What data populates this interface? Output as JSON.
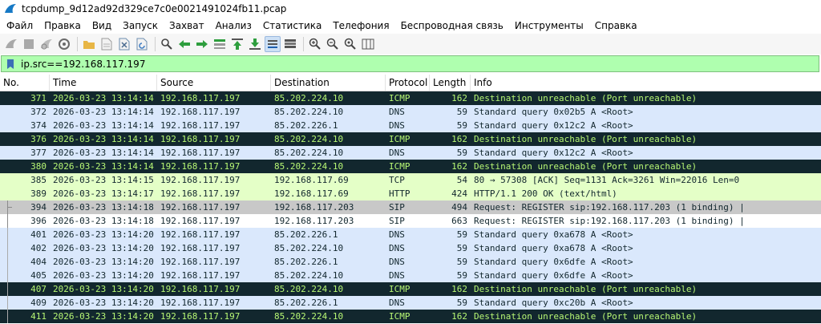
{
  "window": {
    "title": "tcpdump_9d12ad92d329ce7c0e0021491024fb11.pcap"
  },
  "menu": [
    "Файл",
    "Правка",
    "Вид",
    "Запуск",
    "Захват",
    "Анализ",
    "Статистика",
    "Телефония",
    "Беспроводная связь",
    "Инструменты",
    "Справка"
  ],
  "toolbar": {
    "icons": [
      "shark-fin-start-icon",
      "stop-square-icon",
      "restart-fin-icon",
      "capture-options-icon",
      "open-folder-icon",
      "save-file-icon",
      "close-file-icon",
      "reload-icon",
      "find-icon",
      "back-arrow-icon",
      "forward-arrow-icon",
      "goto-packet-icon",
      "first-packet-icon",
      "last-packet-icon",
      "autoscroll-icon",
      "colorize-icon",
      "zoom-in-icon",
      "zoom-out-icon",
      "zoom-normal-icon",
      "resize-columns-icon"
    ],
    "accent": "#2e9e3e"
  },
  "filter": {
    "value": "ip.src==192.168.117.197"
  },
  "columns": [
    "No.",
    "Time",
    "Source",
    "Destination",
    "Protocol",
    "Length",
    "Info"
  ],
  "packets": [
    {
      "no": "371",
      "time": "2026-03-23 13:14:14",
      "src": "192.168.117.197",
      "dst": "85.202.224.10",
      "proto": "ICMP",
      "len": "162",
      "info": "Destination unreachable (Port unreachable)",
      "style": "icmp"
    },
    {
      "no": "372",
      "time": "2026-03-23 13:14:14",
      "src": "192.168.117.197",
      "dst": "85.202.224.10",
      "proto": "DNS",
      "len": "59",
      "info": "Standard query 0x02b5 A <Root>",
      "style": "dns"
    },
    {
      "no": "374",
      "time": "2026-03-23 13:14:14",
      "src": "192.168.117.197",
      "dst": "85.202.226.1",
      "proto": "DNS",
      "len": "59",
      "info": "Standard query 0x12c2 A <Root>",
      "style": "dns"
    },
    {
      "no": "376",
      "time": "2026-03-23 13:14:14",
      "src": "192.168.117.197",
      "dst": "85.202.224.10",
      "proto": "ICMP",
      "len": "162",
      "info": "Destination unreachable (Port unreachable)",
      "style": "icmp"
    },
    {
      "no": "377",
      "time": "2026-03-23 13:14:14",
      "src": "192.168.117.197",
      "dst": "85.202.224.10",
      "proto": "DNS",
      "len": "59",
      "info": "Standard query 0x12c2 A <Root>",
      "style": "dns"
    },
    {
      "no": "380",
      "time": "2026-03-23 13:14:14",
      "src": "192.168.117.197",
      "dst": "85.202.224.10",
      "proto": "ICMP",
      "len": "162",
      "info": "Destination unreachable (Port unreachable)",
      "style": "icmp"
    },
    {
      "no": "385",
      "time": "2026-03-23 13:14:15",
      "src": "192.168.117.197",
      "dst": "192.168.117.69",
      "proto": "TCP",
      "len": "54",
      "info": "80 → 57308 [ACK] Seq=1131 Ack=3261 Win=22016 Len=0",
      "style": "tcp"
    },
    {
      "no": "389",
      "time": "2026-03-23 13:14:17",
      "src": "192.168.117.197",
      "dst": "192.168.117.69",
      "proto": "HTTP",
      "len": "424",
      "info": "HTTP/1.1 200 OK  (text/html)",
      "style": "http"
    },
    {
      "no": "394",
      "time": "2026-03-23 13:14:18",
      "src": "192.168.117.197",
      "dst": "192.168.117.203",
      "proto": "SIP",
      "len": "494",
      "info": "Request: REGISTER sip:192.168.117.203  (1 binding) |",
      "style": "sip selected"
    },
    {
      "no": "396",
      "time": "2026-03-23 13:14:18",
      "src": "192.168.117.197",
      "dst": "192.168.117.203",
      "proto": "SIP",
      "len": "663",
      "info": "Request: REGISTER sip:192.168.117.203  (1 binding) |",
      "style": "sip"
    },
    {
      "no": "401",
      "time": "2026-03-23 13:14:20",
      "src": "192.168.117.197",
      "dst": "85.202.226.1",
      "proto": "DNS",
      "len": "59",
      "info": "Standard query 0xa678 A <Root>",
      "style": "dns"
    },
    {
      "no": "402",
      "time": "2026-03-23 13:14:20",
      "src": "192.168.117.197",
      "dst": "85.202.224.10",
      "proto": "DNS",
      "len": "59",
      "info": "Standard query 0xa678 A <Root>",
      "style": "dns"
    },
    {
      "no": "404",
      "time": "2026-03-23 13:14:20",
      "src": "192.168.117.197",
      "dst": "85.202.226.1",
      "proto": "DNS",
      "len": "59",
      "info": "Standard query 0x6dfe A <Root>",
      "style": "dns"
    },
    {
      "no": "405",
      "time": "2026-03-23 13:14:20",
      "src": "192.168.117.197",
      "dst": "85.202.224.10",
      "proto": "DNS",
      "len": "59",
      "info": "Standard query 0x6dfe A <Root>",
      "style": "dns"
    },
    {
      "no": "407",
      "time": "2026-03-23 13:14:20",
      "src": "192.168.117.197",
      "dst": "85.202.224.10",
      "proto": "ICMP",
      "len": "162",
      "info": "Destination unreachable (Port unreachable)",
      "style": "icmp"
    },
    {
      "no": "409",
      "time": "2026-03-23 13:14:20",
      "src": "192.168.117.197",
      "dst": "85.202.226.1",
      "proto": "DNS",
      "len": "59",
      "info": "Standard query 0xc20b A <Root>",
      "style": "dns"
    },
    {
      "no": "411",
      "time": "2026-03-23 13:14:20",
      "src": "192.168.117.197",
      "dst": "85.202.224.10",
      "proto": "ICMP",
      "len": "162",
      "info": "Destination unreachable (Port unreachable)",
      "style": "icmp"
    }
  ]
}
